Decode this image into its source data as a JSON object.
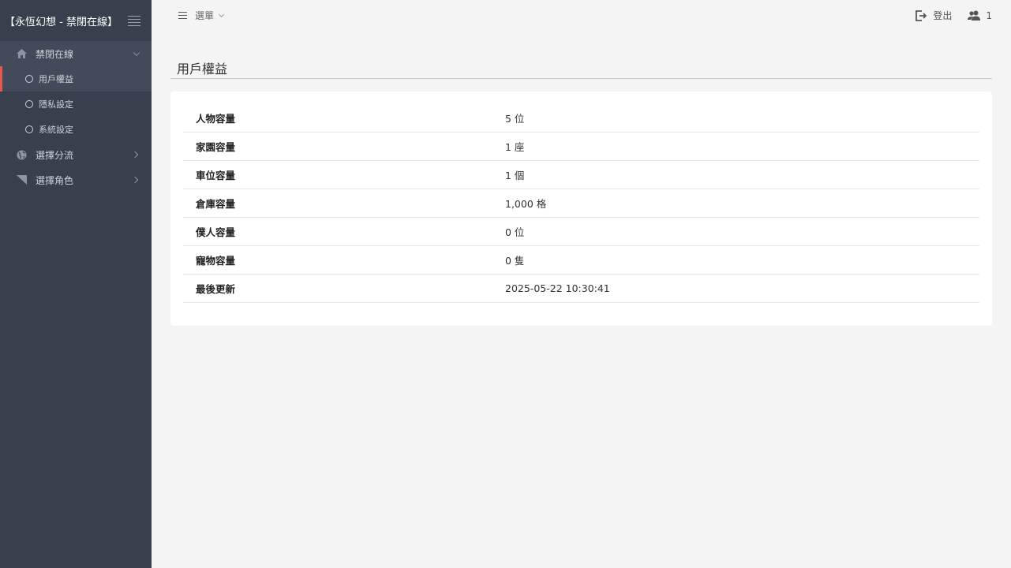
{
  "sidebar": {
    "brand": "【永恆幻想 - 禁閉在線】",
    "groups": [
      {
        "label": "禁閉在線",
        "icon": "home-icon",
        "items": [
          {
            "label": "用戶權益",
            "active": true
          },
          {
            "label": "隱私設定"
          },
          {
            "label": "系統設定"
          }
        ]
      },
      {
        "label": "選擇分流",
        "icon": "globe-icon"
      },
      {
        "label": "選擇角色",
        "icon": "flag-icon"
      }
    ]
  },
  "topbar": {
    "menu_label": "選單",
    "logout_label": "登出",
    "users_count": "1"
  },
  "main": {
    "title": "用戶權益",
    "rows": [
      {
        "label": "人物容量",
        "value": "5 位"
      },
      {
        "label": "家園容量",
        "value": "1 座"
      },
      {
        "label": "車位容量",
        "value": "1 個"
      },
      {
        "label": "倉庫容量",
        "value": "1,000 格"
      },
      {
        "label": "僕人容量",
        "value": "0 位"
      },
      {
        "label": "寵物容量",
        "value": "0 隻"
      },
      {
        "label": "最後更新",
        "value": "2025-05-22 10:30:41"
      }
    ]
  },
  "colors": {
    "sidebar_bg": "#383f4d",
    "active_accent": "#e8584f",
    "page_bg": "#f4f4f4"
  }
}
